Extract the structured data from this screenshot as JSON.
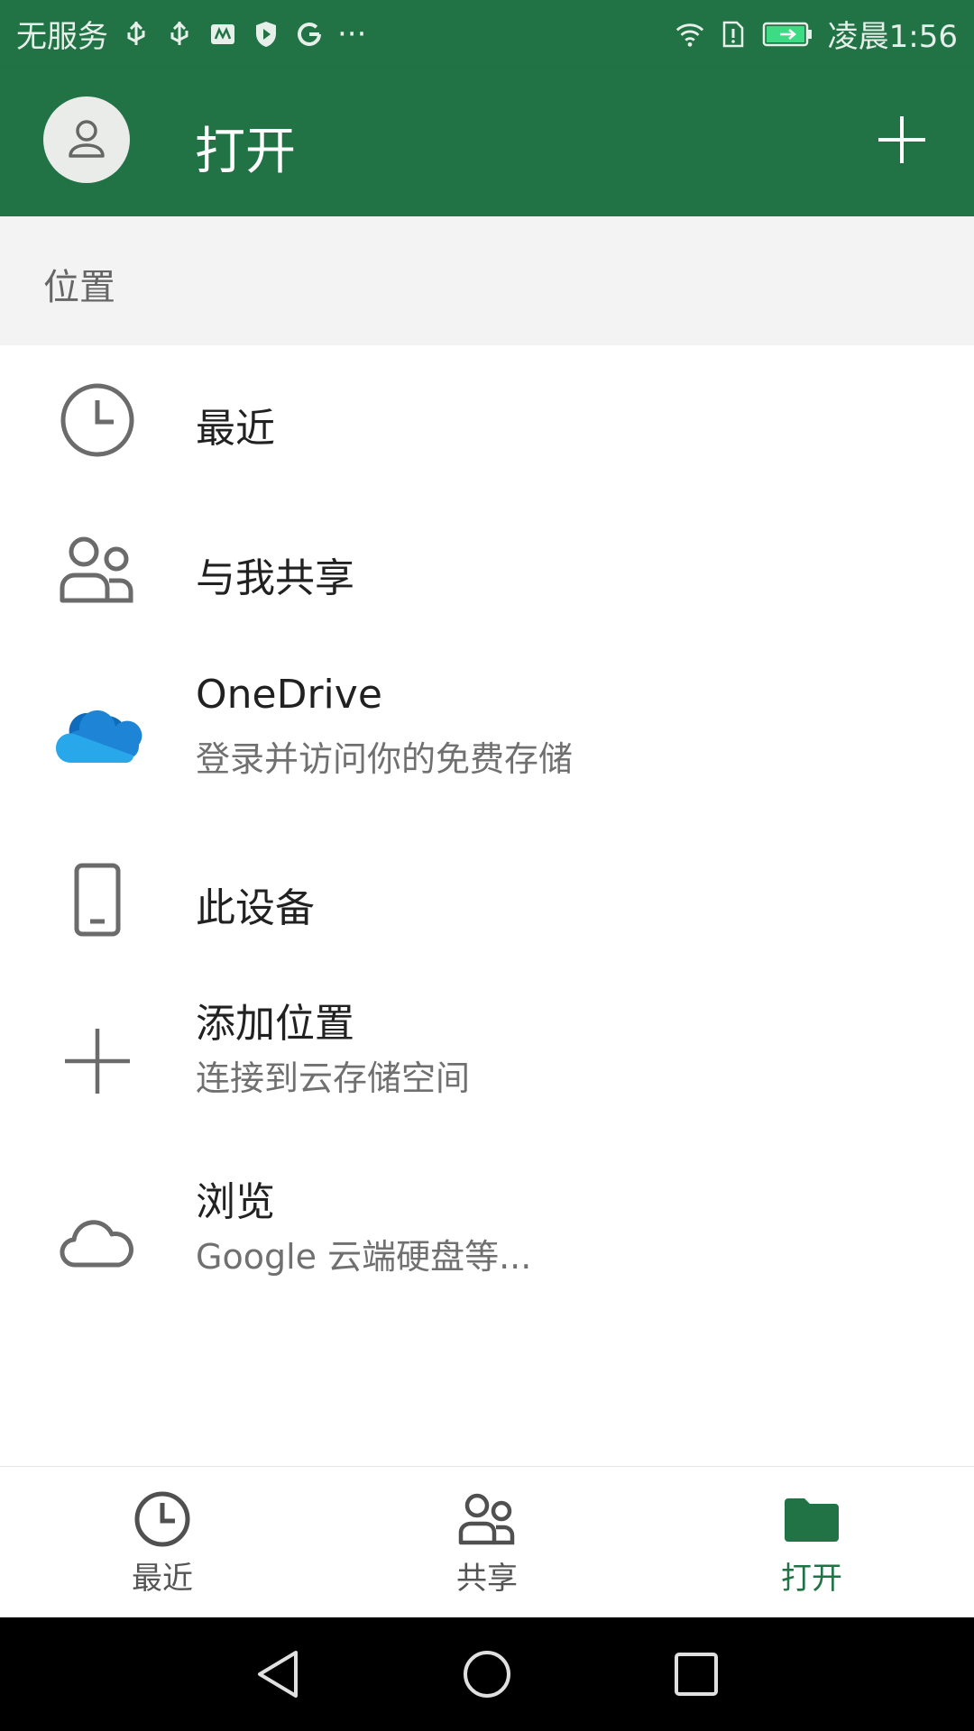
{
  "status_bar": {
    "left_text": "无服务",
    "more": "···",
    "time": "凌晨1:56",
    "icons": [
      "usb-icon",
      "usb-icon",
      "huawei-icon",
      "shield-icon",
      "google-icon",
      "wifi-icon",
      "sim-alert-icon",
      "battery-icon"
    ]
  },
  "app_bar": {
    "title": "打开",
    "add_icon": "plus-icon",
    "avatar_icon": "person-icon"
  },
  "section": {
    "header": "位置"
  },
  "locations": [
    {
      "title": "最近",
      "subtitle": "",
      "icon": "clock-icon"
    },
    {
      "title": "与我共享",
      "subtitle": "",
      "icon": "people-icon"
    },
    {
      "title": "OneDrive",
      "subtitle": "登录并访问你的免费存储",
      "icon": "onedrive-icon"
    },
    {
      "title": "此设备",
      "subtitle": "",
      "icon": "phone-icon"
    },
    {
      "title": "添加位置",
      "subtitle": "连接到云存储空间",
      "icon": "plus-icon"
    },
    {
      "title": "浏览",
      "subtitle": "Google 云端硬盘等...",
      "icon": "cloud-icon"
    }
  ],
  "bottom_nav": [
    {
      "label": "最近",
      "icon": "clock-icon",
      "active": false
    },
    {
      "label": "共享",
      "icon": "people-icon",
      "active": false
    },
    {
      "label": "打开",
      "icon": "folder-icon",
      "active": true
    }
  ],
  "colors": {
    "brand": "#217346",
    "onedrive_dark": "#0f6cbd",
    "onedrive_light": "#28a8ea"
  }
}
